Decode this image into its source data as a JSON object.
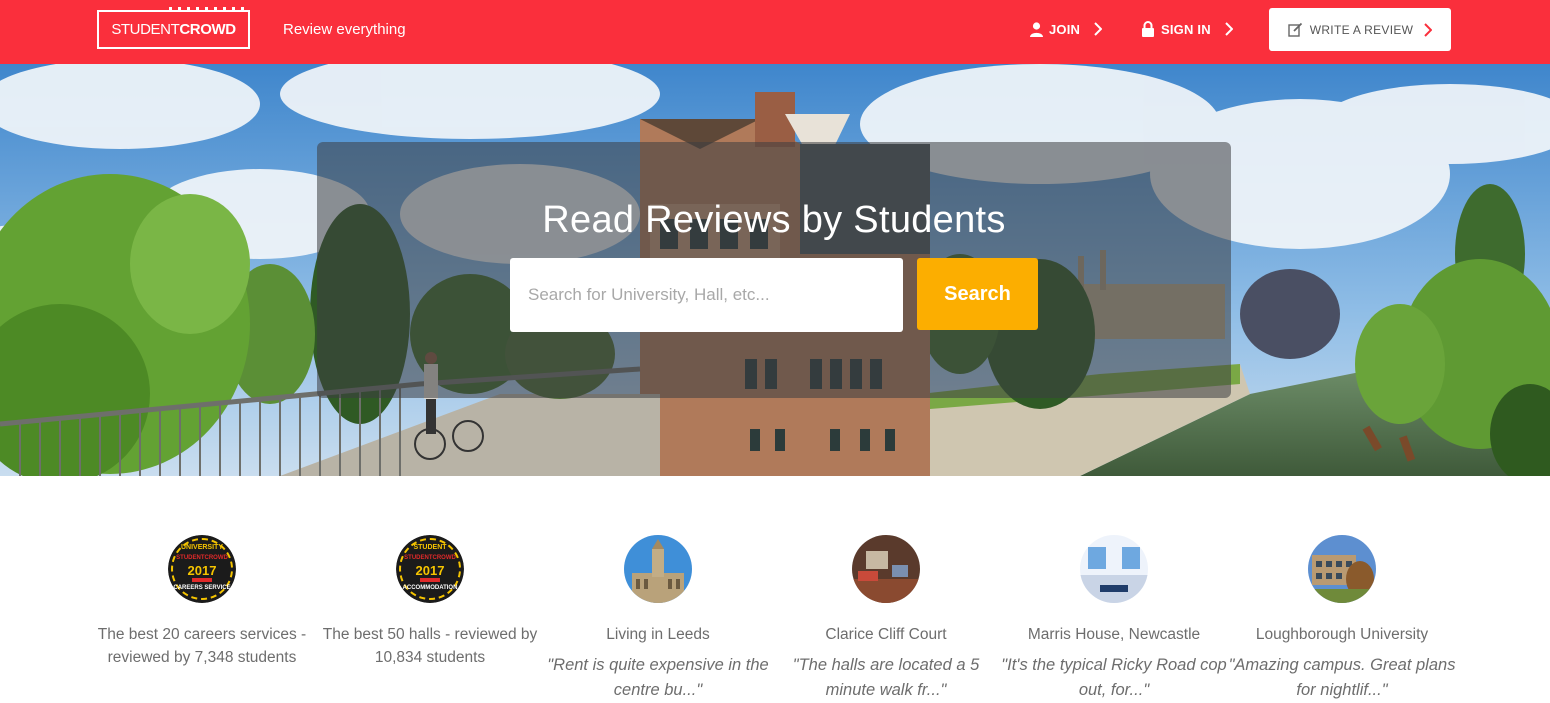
{
  "header": {
    "logo": {
      "part1": "STUDENT",
      "part2": "CROWD"
    },
    "tagline": "Review everything",
    "join_label": "JOIN",
    "signin_label": "SIGN IN",
    "write_review_label": "WRITE A REVIEW",
    "brand_color": "#fa2f3c"
  },
  "hero": {
    "title": "Read Reviews by Students",
    "search_placeholder": "Search for University, Hall, etc...",
    "search_button": "Search",
    "search_button_color": "#fcae00"
  },
  "features": [
    {
      "image": "careers-award-badge",
      "badge": {
        "top": "UNIVERSITY",
        "mid": "STUDENTCROWD",
        "year": "2017",
        "bottom": "CAREERS SERVICE"
      },
      "title": "The best 20 careers services - reviewed by 7,348 students",
      "quote": ""
    },
    {
      "image": "accommodation-award-badge",
      "badge": {
        "top": "STUDENT",
        "mid": "STUDENTCROWD",
        "year": "2017",
        "bottom": "ACCOMMODATION"
      },
      "title": "The best 50 halls - reviewed by 10,834 students",
      "quote": ""
    },
    {
      "image": "leeds-town-hall-photo",
      "title": "Living in Leeds",
      "quote": "\"Rent is quite expensive in the centre bu...\""
    },
    {
      "image": "clarice-cliff-room-photo",
      "title": "Clarice Cliff Court",
      "quote": "\"The halls are located a 5 minute walk fr...\""
    },
    {
      "image": "marris-house-room-photo",
      "title": "Marris House, Newcastle",
      "quote": "\"It's the typical Ricky Road cop out, for...\""
    },
    {
      "image": "loughborough-campus-photo",
      "title": "Loughborough University",
      "quote": "\"Amazing campus. Great plans for nightlif...\""
    }
  ]
}
